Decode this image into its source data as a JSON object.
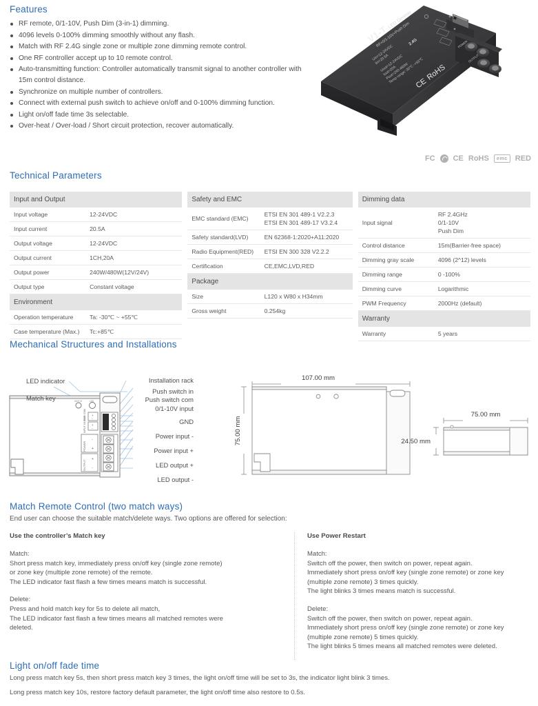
{
  "features": {
    "title": "Features",
    "items": [
      "RF remote, 0/1-10V, Push Dim (3-in-1) dimming.",
      "4096 levels 0-100% dimming smoothly without any flash.",
      "Match with RF 2.4G single zone or multiple zone dimming remote control.",
      "One RF controller accept up to 10 remote control.",
      "Auto-transmitting function: Controller automatically transmit signal to another controller with 15m control distance.",
      "Synchronize on multiple number of controllers.",
      "Connect with external push switch to achieve on/off and 0-100% dimming function.",
      "Light on/off fade time 3s selectable.",
      "Over-heat / Over-load / Short circuit protection, recover automatically."
    ]
  },
  "product": {
    "model": "V1-T",
    "model_suffix": "LED Dimmer",
    "subtitle": "RF+0/1-10V+Push Dim",
    "badge": "2.4G",
    "spec_lines": [
      "Uin=12-24VDC",
      "Iin=20.5A",
      "Uout=12-24VDC",
      "Iout=20A",
      "Pout=240-480W",
      "Temp range:-30℃~+55℃"
    ],
    "marks": "CE  RoHS",
    "terminal_labels": [
      "POWER",
      "OUTPUT"
    ],
    "body_color": "#3a3a3c"
  },
  "certifications": [
    {
      "label": "FC",
      "type": "text"
    },
    {
      "label": "c-tick",
      "type": "icon"
    },
    {
      "label": "CE",
      "type": "text"
    },
    {
      "label": "RoHS",
      "type": "text"
    },
    {
      "label": "emc",
      "type": "boxed"
    },
    {
      "label": "RED",
      "type": "text"
    }
  ],
  "technical": {
    "title": "Technical Parameters",
    "columns": [
      {
        "groups": [
          {
            "header": "Input and Output",
            "rows": [
              {
                "key": "Input voltage",
                "value": "12-24VDC"
              },
              {
                "key": "Input current",
                "value": "20.5A"
              },
              {
                "key": "Output voltage",
                "value": "12-24VDC"
              },
              {
                "key": "Output current",
                "value": "1CH,20A"
              },
              {
                "key": "Output power",
                "value": "240W/480W(12V/24V)"
              },
              {
                "key": "Output type",
                "value": "Constant voltage"
              }
            ]
          },
          {
            "header": "Environment",
            "rows": [
              {
                "key": "Operation temperature",
                "value": "Ta: -30℃ ~ +55℃"
              },
              {
                "key": "Case temperature (Max.)",
                "value": "Tc:+85℃"
              }
            ]
          }
        ]
      },
      {
        "groups": [
          {
            "header": "Safety and EMC",
            "rows": [
              {
                "key": "EMC standard (EMC)",
                "value": "ETSI EN 301 489-1 V2.2.3",
                "value2": "ETSI EN 301 489-17 V3.2.4"
              },
              {
                "key": "Safety standard(LVD)",
                "value": "EN 62368-1:2020+A11:2020"
              },
              {
                "key": "Radio Equipment(RED)",
                "value": "ETSI EN 300 328 V2.2.2"
              },
              {
                "key": "Certification",
                "value": "CE,EMC,LVD,RED"
              }
            ]
          },
          {
            "header": "Package",
            "rows": [
              {
                "key": "Size",
                "value": "L120 x W80 x H34mm"
              },
              {
                "key": "Gross weight",
                "value": "0.254kg"
              }
            ]
          }
        ]
      },
      {
        "groups": [
          {
            "header": "Dimming data",
            "rows": [
              {
                "key": "Input signal",
                "value": "RF 2.4GHz",
                "value2": "0/1-10V",
                "value3": "Push Dim"
              },
              {
                "key": "Control distance",
                "value": "15m(Barrier-free space)"
              },
              {
                "key": "Dimming gray scale",
                "value": "4096 (2^12) levels"
              },
              {
                "key": "Dimming range",
                "value": "0 -100%"
              },
              {
                "key": "Dimming curve",
                "value": "Logarithmic"
              },
              {
                "key": "PWM Frequency",
                "value": "2000Hz (default)"
              }
            ]
          },
          {
            "header": "Warranty",
            "rows": [
              {
                "key": "Warranty",
                "value": "5 years"
              }
            ]
          }
        ]
      }
    ]
  },
  "mechanical": {
    "title": "Mechanical Structures and Installations",
    "left_labels": [
      "LED indicator",
      "Match key"
    ],
    "right_labels": [
      "Installation rack",
      "Push switch in",
      "Push switch com",
      "0/1-10V input",
      "GND",
      "Power input -",
      "Power input +",
      "LED output +",
      "LED output -"
    ],
    "board_labels": {
      "push_dim": "PUSH DIM",
      "input": "INPUT 0/1-10V",
      "power": "POWER",
      "output": "OUTPUT"
    },
    "dimensions": {
      "width": "107.00 mm",
      "height": "75.00 mm",
      "depth_width": "75.00 mm",
      "depth_height": "24.50 mm"
    }
  },
  "match": {
    "title": "Match Remote Control (two match ways)",
    "intro": "End user can choose the suitable match/delete ways. Two options are offered for selection:",
    "left": {
      "heading": "Use the controller’s Match key",
      "blocks": [
        {
          "label": "Match:",
          "lines": [
            "Short press match key, immediately press on/off key (single zone remote)",
            "or zone key (multiple zone remote) of the remote.",
            "The LED indicator fast flash a few times means match is successful."
          ]
        },
        {
          "label": "Delete:",
          "lines": [
            "Press and hold match key for 5s to delete all match,",
            "The LED indicator fast flash a few times means all matched remotes were",
            "deleted."
          ]
        }
      ]
    },
    "right": {
      "heading": "Use Power Restart",
      "blocks": [
        {
          "label": "Match:",
          "lines": [
            "Switch off the power, then switch on power, repeat again.",
            "Immediately short press on/off key (single zone remote) or zone key",
            "(multiple zone remote) 3 times quickly.",
            "The light blinks 3 times means match is successful."
          ]
        },
        {
          "label": "Delete:",
          "lines": [
            "Switch off the power, then switch on power, repeat again.",
            "Immediately short press on/off key (single zone remote) or zone key",
            "(multiple zone remote) 5 times quickly.",
            "The light blinks 5 times means all matched remotes were deleted."
          ]
        }
      ]
    }
  },
  "fade": {
    "title": "Light on/off fade time",
    "lines": [
      "Long press match key 5s, then short press match key 3 times, the light on/off time will be set to 3s, the indicator light blink 3 times.",
      "Long press match key 10s, restore factory default parameter, the light on/off time also restore to 0.5s."
    ]
  },
  "colors": {
    "heading": "#2e6db4",
    "table_header_bg": "#e4e4e4",
    "body_text": "#555555",
    "leader_line": "#9fc2e0"
  }
}
